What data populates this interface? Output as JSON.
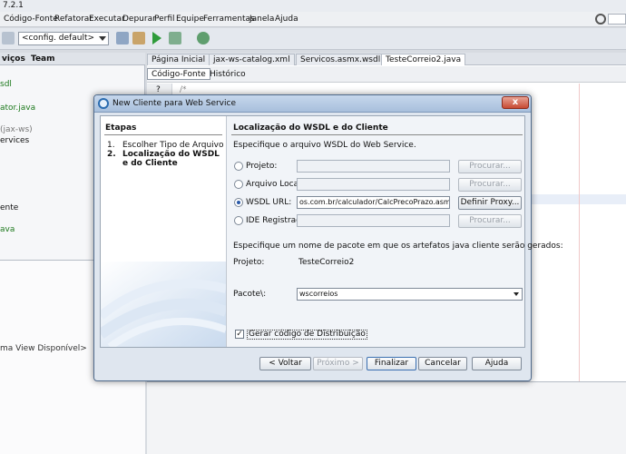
{
  "ide": {
    "title": "7.2.1",
    "menu": [
      "Código-Fonte",
      "Refatorar",
      "Executar",
      "Depurar",
      "Perfil",
      "Equipe",
      "Ferramentas",
      "Janela",
      "Ajuda"
    ],
    "config": "<config. default>",
    "left_tabs": [
      "viços",
      "Team"
    ],
    "left_items": [
      "sdl",
      "ator.java",
      "(jax-ws)",
      "ervices",
      "ente",
      "ava"
    ],
    "left_lower_text": "ma View Disponível>",
    "editor_tabs": [
      "Página Inicial",
      "jax-ws-catalog.xml",
      "Servicos.asmx.wsdl",
      "TesteCorreio2.java"
    ],
    "editor_view_tabs": [
      "Código-Fonte",
      "Histórico"
    ],
    "gutter_text": "?",
    "code_fragment": "/*"
  },
  "dialog": {
    "title": "New Cliente para Web Service",
    "close_label": "x",
    "steps_title": "Etapas",
    "steps": [
      {
        "num": "1.",
        "label": "Escolher Tipo de Arquivo"
      },
      {
        "num": "2.",
        "label": "Localização do WSDL e do Cliente"
      }
    ],
    "section_title": "Localização do WSDL e do Cliente",
    "instruction": "Especifique o arquivo WSDL do Web Service.",
    "options": [
      {
        "label": "Projeto:",
        "value": "",
        "button": "Procurar...",
        "selected": false
      },
      {
        "label": "Arquivo Local:",
        "value": "",
        "button": "Procurar...",
        "selected": false
      },
      {
        "label": "WSDL URL:",
        "value": "os.com.br/calculador/CalcPrecoPrazo.asmx?WSDL",
        "button": "Definir Proxy...",
        "selected": true
      },
      {
        "label": "IDE Registrado:",
        "value": "",
        "button": "Procurar...",
        "selected": false
      }
    ],
    "package_instruction": "Especifique um nome de pacote em que os artefatos java cliente serão gerados:",
    "project_label": "Projeto:",
    "project_value": "TesteCorreio2",
    "package_label": "Pacote\\:",
    "package_value": "wscorreios",
    "checkbox_label": "Gerar código de Distribuição",
    "checkbox_checked": true,
    "buttons": {
      "back": "< Voltar",
      "next": "Próximo >",
      "finish": "Finalizar",
      "cancel": "Cancelar",
      "help": "Ajuda"
    }
  }
}
